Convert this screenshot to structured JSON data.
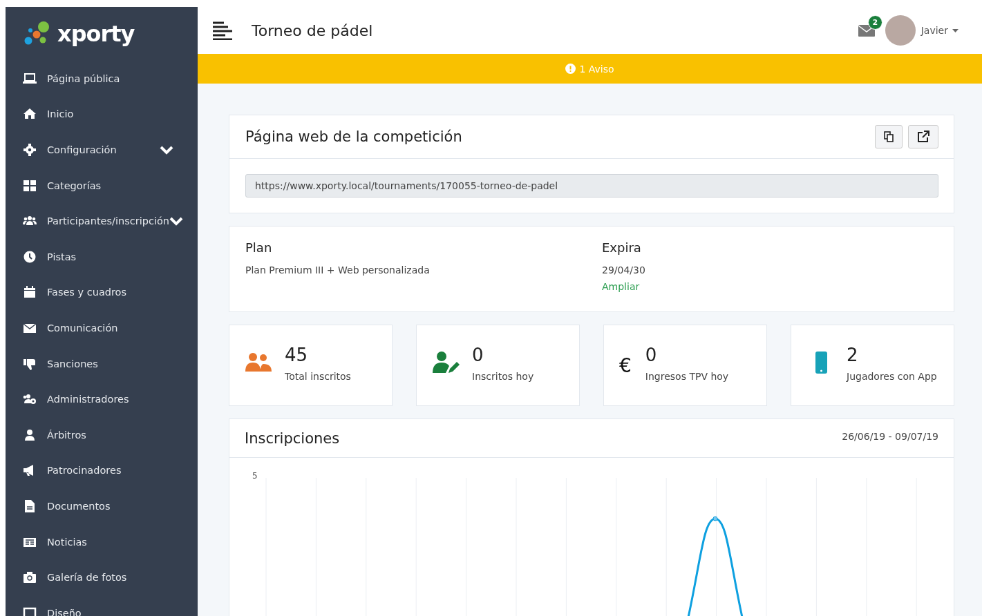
{
  "brand": {
    "name": "xporty"
  },
  "sidebar": {
    "items": [
      {
        "label": "Página pública",
        "has_submenu": false
      },
      {
        "label": "Inicio",
        "has_submenu": false
      },
      {
        "label": "Configuración",
        "has_submenu": true
      },
      {
        "label": "Categorías",
        "has_submenu": false
      },
      {
        "label": "Participantes/inscripción",
        "has_submenu": true
      },
      {
        "label": "Pistas",
        "has_submenu": false
      },
      {
        "label": "Fases y cuadros",
        "has_submenu": false
      },
      {
        "label": "Comunicación",
        "has_submenu": false
      },
      {
        "label": "Sanciones",
        "has_submenu": false
      },
      {
        "label": "Administradores",
        "has_submenu": false
      },
      {
        "label": "Árbitros",
        "has_submenu": false
      },
      {
        "label": "Patrocinadores",
        "has_submenu": false
      },
      {
        "label": "Documentos",
        "has_submenu": false
      },
      {
        "label": "Noticias",
        "has_submenu": false
      },
      {
        "label": "Galería de fotos",
        "has_submenu": false
      },
      {
        "label": "Diseño",
        "has_submenu": false
      }
    ]
  },
  "header": {
    "title": "Torneo de pádel",
    "messages_badge": "2",
    "user": "Javier"
  },
  "alert": {
    "text": "1 Aviso"
  },
  "website_card": {
    "title": "Página web de la competición",
    "url": "https://www.xporty.local/tournaments/170055-torneo-de-padel"
  },
  "plan_card": {
    "plan_label": "Plan",
    "plan_value": "Plan Premium III + Web personalizada",
    "expires_label": "Expira",
    "expires_value": "29/04/30",
    "extend_link": "Ampliar"
  },
  "stats": [
    {
      "value": "45",
      "label": "Total inscritos"
    },
    {
      "value": "0",
      "label": "Inscritos hoy"
    },
    {
      "value": "0",
      "label": "Ingresos TPV hoy",
      "symbol": "€"
    },
    {
      "value": "2",
      "label": "Jugadores con App"
    }
  ],
  "registrations": {
    "title": "Inscripciones",
    "date_range": "26/06/19 - 09/07/19",
    "y_axis_label": "5"
  }
}
